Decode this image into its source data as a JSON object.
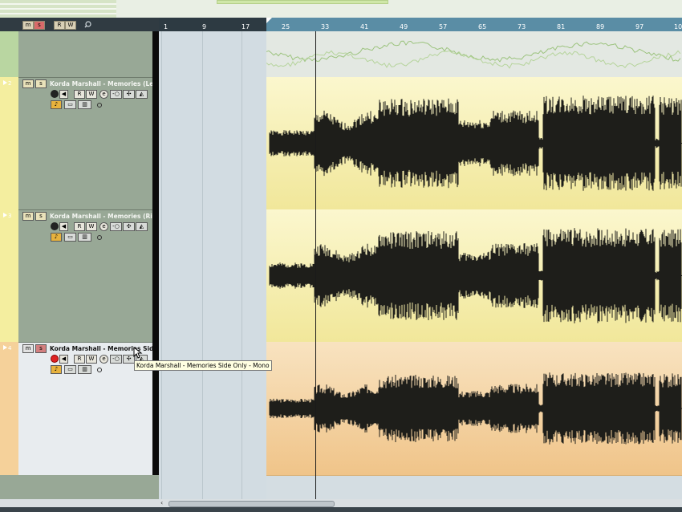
{
  "toolbar": {
    "buttons": [
      {
        "label": "m",
        "icon": "mute-global-icon"
      },
      {
        "label": "s",
        "icon": "solo-global-icon"
      },
      {
        "label": "R",
        "icon": "read-global-icon"
      },
      {
        "label": "W",
        "icon": "write-global-icon"
      }
    ],
    "search_icon": "magnifier-icon"
  },
  "ruler": {
    "bars": [
      "1",
      "9",
      "17",
      "25",
      "33",
      "41",
      "49",
      "57",
      "65",
      "73",
      "81",
      "89",
      "97",
      "10"
    ]
  },
  "tracks": [
    {
      "number": "2",
      "name": "Korda Marshall - Memories (Left)",
      "mute_label": "m",
      "solo_label": "s",
      "read_label": "R",
      "write_label": "W",
      "record_enabled": false,
      "color": "#f4ee9f"
    },
    {
      "number": "3",
      "name": "Korda Marshall - Memories (Right)",
      "mute_label": "m",
      "solo_label": "s",
      "read_label": "R",
      "write_label": "W",
      "record_enabled": false,
      "color": "#f4ee9f"
    },
    {
      "number": "4",
      "name": "Korda Marshall - Memories Side Onl",
      "mute_label": "m",
      "solo_label": "s",
      "read_label": "R",
      "write_label": "W",
      "record_enabled": true,
      "color": "#f5d19a"
    }
  ],
  "tooltip": "Korda Marshall - Memories Side Only - Mono",
  "colors": {
    "yellow_lane": "#f4ee9f",
    "orange_lane": "#f5d19a",
    "ruler_blue": "#5a8da5",
    "track_head": "#98a896"
  }
}
